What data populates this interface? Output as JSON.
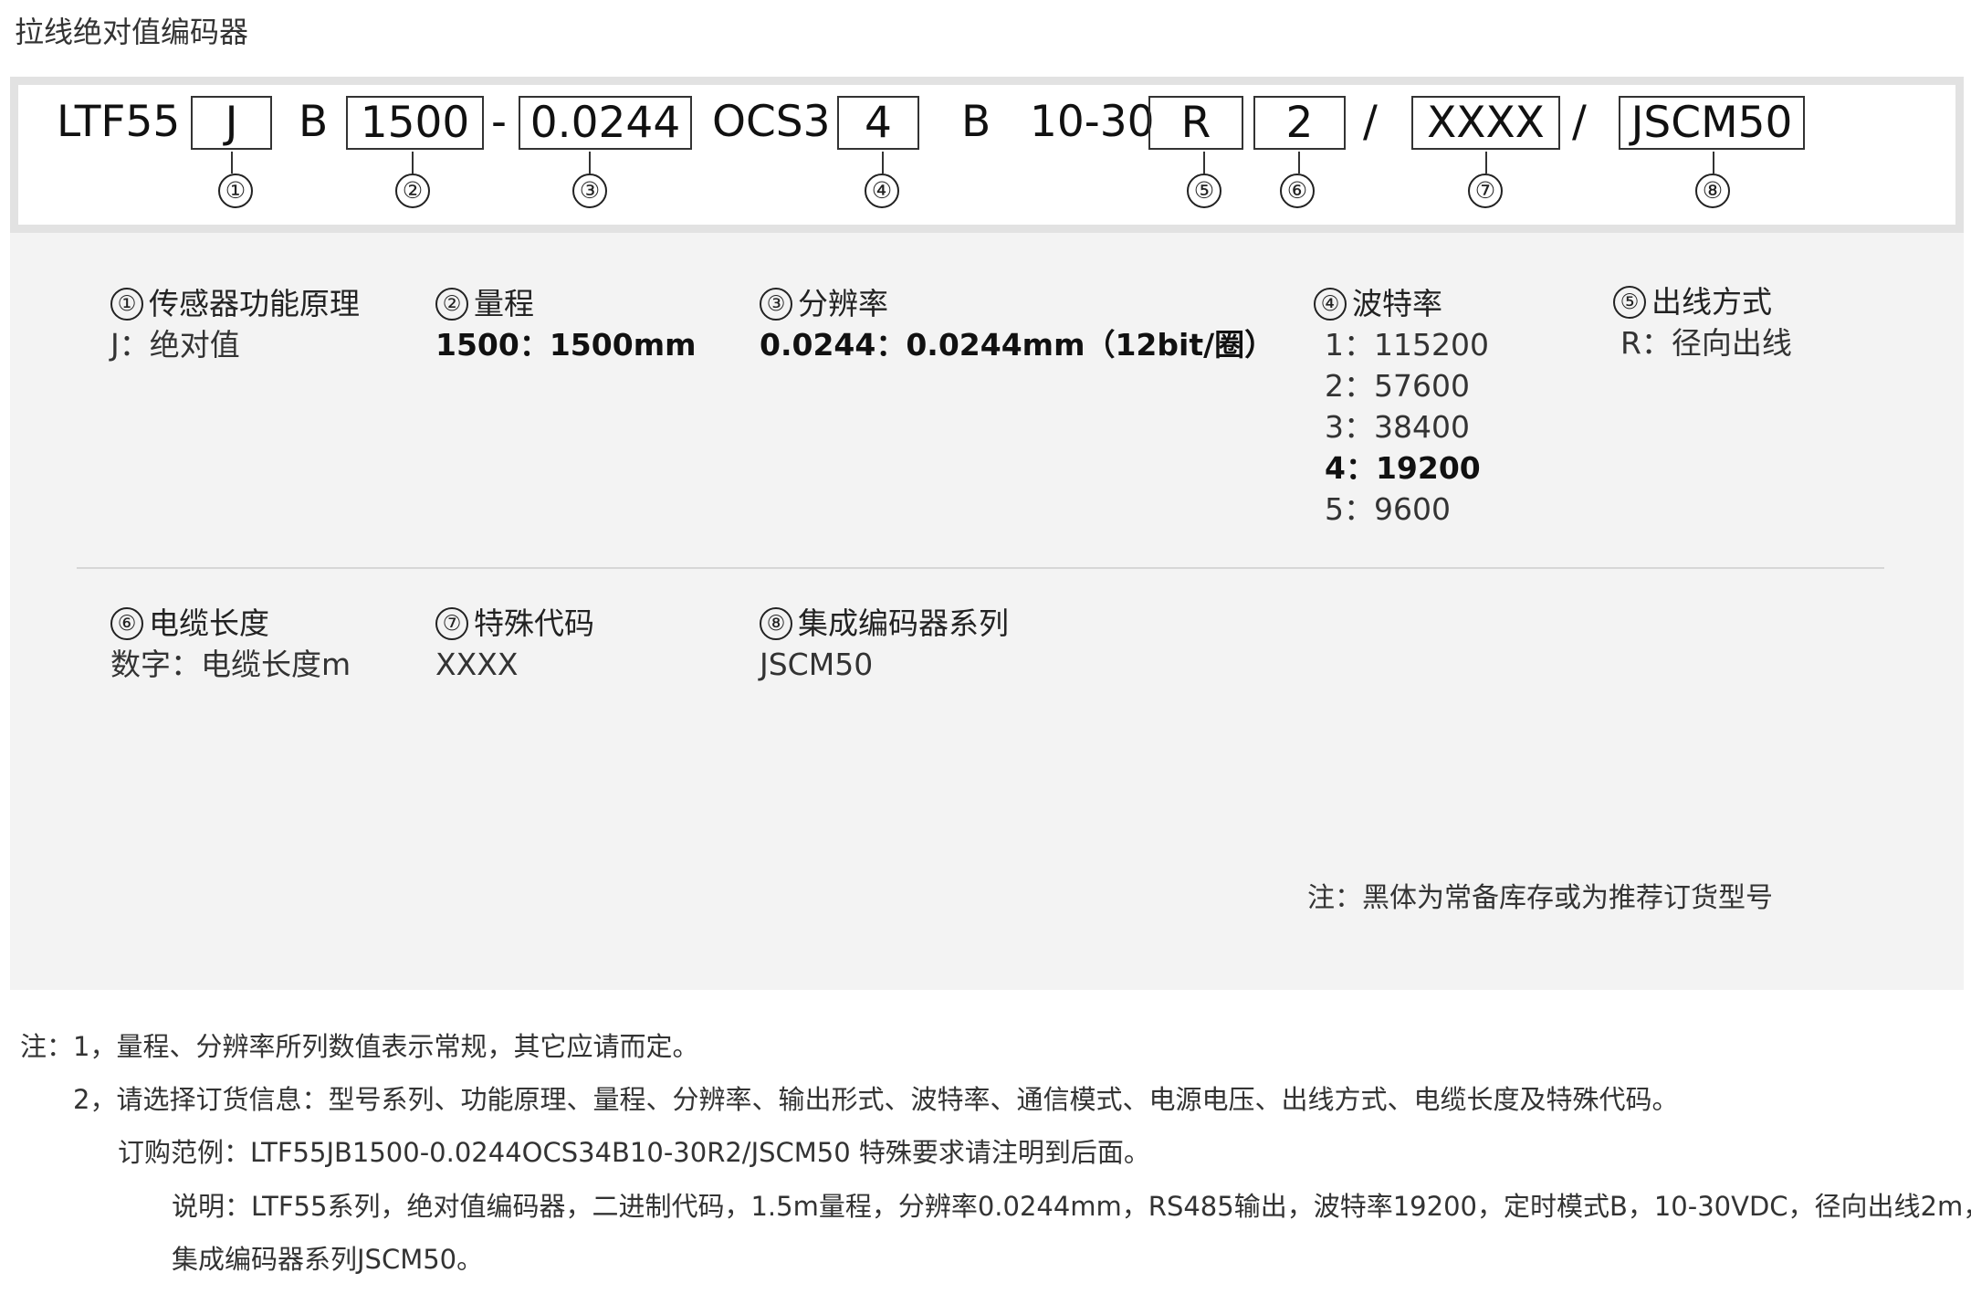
{
  "title": "拉线绝对值编码器",
  "model_code": {
    "prefix": "LTF55",
    "box1": "J",
    "sep_b1": "B",
    "box2": "1500",
    "dash": "-",
    "box3": "0.0244",
    "sep_ocs": "OCS3",
    "box4": "4",
    "sep_b2": "B",
    "sep_volt": "10-30",
    "box5": "R",
    "box6": "2",
    "slash1": "/",
    "box7": "XXXX",
    "slash2": "/",
    "box8": "JSCM50",
    "markers": [
      "①",
      "②",
      "③",
      "④",
      "⑤",
      "⑥",
      "⑦",
      "⑧"
    ]
  },
  "sections": {
    "s1": {
      "num": "①",
      "title": "传感器功能原理",
      "lines": [
        "J：绝对值"
      ]
    },
    "s2": {
      "num": "②",
      "title": "量程",
      "lines": [
        "1500：1500mm"
      ]
    },
    "s3": {
      "num": "③",
      "title": "分辨率",
      "lines": [
        "0.0244：0.0244mm（12bit/圈）"
      ]
    },
    "s4": {
      "num": "④",
      "title": "波特率",
      "lines": [
        "1：115200",
        "2：57600",
        "3：38400",
        "4：19200",
        "5：9600"
      ]
    },
    "s5": {
      "num": "⑤",
      "title": "出线方式",
      "lines": [
        "R：径向出线"
      ]
    },
    "s6": {
      "num": "⑥",
      "title": "电缆长度",
      "lines": [
        "数字：电缆长度m"
      ]
    },
    "s7": {
      "num": "⑦",
      "title": "特殊代码",
      "lines": [
        "XXXX"
      ]
    },
    "s8": {
      "num": "⑧",
      "title": "集成编码器系列",
      "lines": [
        "JSCM50"
      ]
    }
  },
  "legend_note": "注：黑体为常备库存或为推荐订货型号",
  "footnotes": {
    "n1": "注：1，量程、分辨率所列数值表示常规，其它应请而定。",
    "n2": "2，请选择订货信息：型号系列、功能原理、量程、分辨率、输出形式、波特率、通信模式、电源电压、出线方式、电缆长度及特殊代码。",
    "n3": "订购范例：LTF55JB1500-0.0244OCS34B10-30R2/JSCM50 特殊要求请注明到后面。",
    "n4": "说明：LTF55系列，绝对值编码器，二进制代码，1.5m量程，分辨率0.0244mm，RS485输出，波特率19200，定时模式B，10-30VDC，径向出线2m，",
    "n5": "集成编码器系列JSCM50。"
  }
}
